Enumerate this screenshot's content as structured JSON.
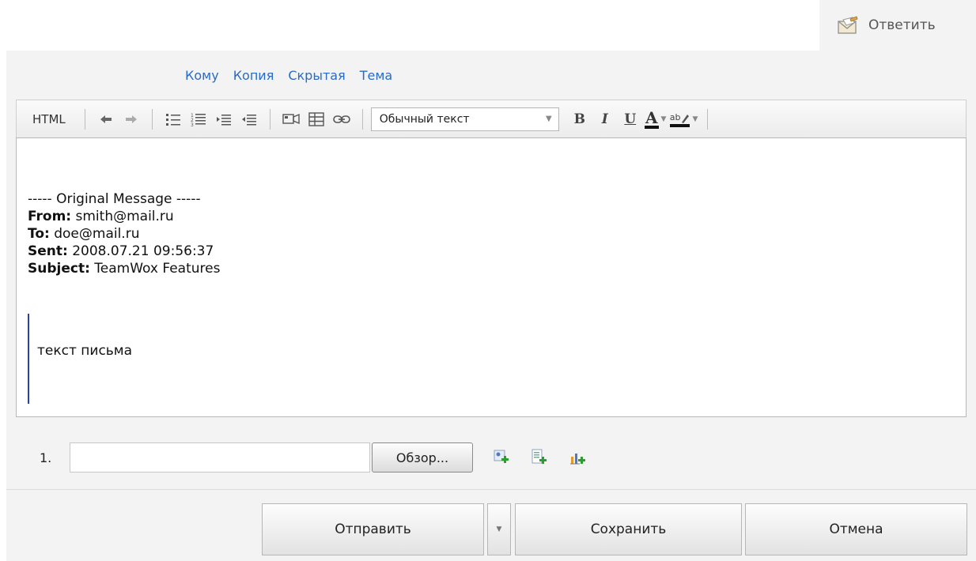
{
  "tab": {
    "label": "Ответить",
    "icon": "reply-envelope-icon"
  },
  "header_links": [
    "Кому",
    "Копия",
    "Скрытая",
    "Тема"
  ],
  "toolbar": {
    "html_label": "HTML",
    "style_select": "Обычный текст",
    "bold": "B",
    "italic": "I",
    "underline": "U",
    "font_color": "A",
    "highlight": "ab"
  },
  "editor": {
    "original_header": "----- Original Message -----",
    "from_label": "From:",
    "from_value": "smith@mail.ru",
    "to_label": "To:",
    "to_value": "doe@mail.ru",
    "sent_label": "Sent:",
    "sent_value": "2008.07.21 09:56:37",
    "subject_label": "Subject:",
    "subject_value": "TeamWox Features",
    "quoted_text": "текст письма"
  },
  "attachments": {
    "number": "1.",
    "value": "",
    "browse_label": "Обзор..."
  },
  "buttons": {
    "send": "Отправить",
    "save": "Сохранить",
    "cancel": "Отмена"
  },
  "colors": {
    "link": "#2a6bc8",
    "panel_bg": "#f3f3f3",
    "quote_bar": "#2c3db8"
  }
}
